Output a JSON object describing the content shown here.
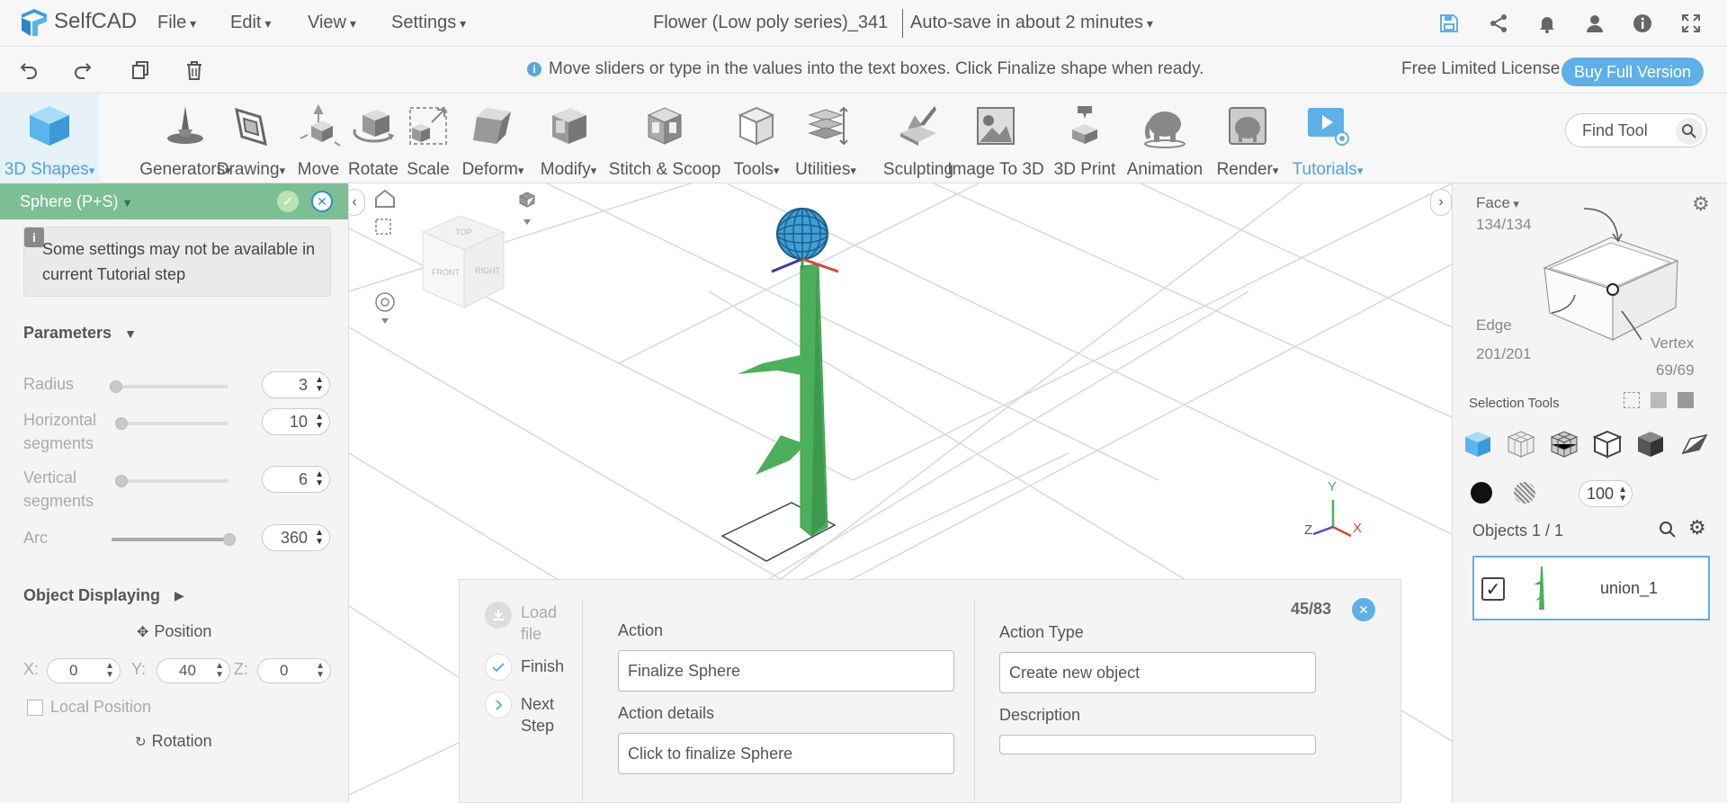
{
  "app": {
    "name": "SelfCAD",
    "menus": [
      "File",
      "Edit",
      "View",
      "Settings"
    ],
    "doc_title": "Flower (Low poly series)_341",
    "autosave": "Auto-save in about 2 minutes"
  },
  "topbar_icons": [
    "save-icon",
    "share-icon",
    "bell-icon",
    "user-icon",
    "info-icon",
    "fullscreen-icon"
  ],
  "bar2": {
    "icons": [
      "undo-icon",
      "redo-icon",
      "copy-icon",
      "trash-icon"
    ],
    "hint": "Move sliders or type in the values into the text boxes. Click Finalize shape when ready.",
    "license": "Free Limited License",
    "buy_label": "Buy Full Version"
  },
  "toolbar": {
    "tools": [
      {
        "label": "3D Shapes",
        "icon": "cube-icon"
      },
      {
        "label": "Generators",
        "icon": "generators-icon"
      },
      {
        "label": "Drawing",
        "icon": "drawing-icon"
      },
      {
        "label": "Move",
        "icon": "move-icon"
      },
      {
        "label": "Rotate",
        "icon": "rotate-icon"
      },
      {
        "label": "Scale",
        "icon": "scale-icon"
      },
      {
        "label": "Deform",
        "icon": "deform-icon"
      },
      {
        "label": "Modify",
        "icon": "modify-icon"
      },
      {
        "label": "Stitch & Scoop",
        "icon": "stitch-icon"
      },
      {
        "label": "Tools",
        "icon": "tools-icon"
      },
      {
        "label": "Utilities",
        "icon": "utilities-icon"
      },
      {
        "label": "Sculpting",
        "icon": "sculpting-icon"
      },
      {
        "label": "Image To 3D",
        "icon": "image-to-3d-icon"
      },
      {
        "label": "3D Print",
        "icon": "printer-icon"
      },
      {
        "label": "Animation",
        "icon": "animation-icon"
      },
      {
        "label": "Render",
        "icon": "render-icon"
      },
      {
        "label": "Tutorials",
        "icon": "tutorials-icon"
      }
    ],
    "find_placeholder": "Find Tool"
  },
  "left": {
    "title": "Sphere (P+S)",
    "notice": "Some settings may not be available in current Tutorial step",
    "parameters_heading": "Parameters",
    "params": [
      {
        "label": "Radius",
        "value": "3"
      },
      {
        "label": "Horizontal segments",
        "value": "10"
      },
      {
        "label": "Vertical segments",
        "value": "6"
      },
      {
        "label": "Arc",
        "value": "360"
      }
    ],
    "object_displaying": "Object Displaying",
    "position": "Position",
    "x_label": "X:",
    "x_value": "0",
    "y_label": "Y:",
    "y_value": "40",
    "z_label": "Z:",
    "z_value": "0",
    "local_position": "Local Position",
    "rotation": "Rotation"
  },
  "tutorial": {
    "steps": [
      {
        "label": "Load file",
        "state": "done"
      },
      {
        "label": "Finish",
        "state": "check"
      },
      {
        "label": "Next Step",
        "state": "next"
      }
    ],
    "action_label": "Action",
    "action_value": "Finalize Sphere",
    "action_details_label": "Action details",
    "action_details_value": "Click to finalize Sphere",
    "action_type_label": "Action Type",
    "action_type_value": "Create new object",
    "description_label": "Description",
    "description_value": "",
    "counter": "45/83"
  },
  "right": {
    "face_label": "Face",
    "face_count": "134/134",
    "edge_label": "Edge",
    "edge_count": "201/201",
    "vertex_label": "Vertex",
    "vertex_count": "69/69",
    "selection_tools": "Selection Tools",
    "opacity_value": "100",
    "objects_title": "Objects 1 / 1",
    "object_name": "union_1"
  },
  "viewport": {
    "axis_x": "X",
    "axis_y": "Y",
    "axis_z": "Z",
    "cube_front": "FRONT",
    "cube_right": "RIGHT",
    "cube_top": "TOP"
  },
  "colors": {
    "accent": "#5fb0e6",
    "panel_header": "#7cbf94",
    "stem": "#4caf5d",
    "sphere": "#3ea0d8"
  }
}
